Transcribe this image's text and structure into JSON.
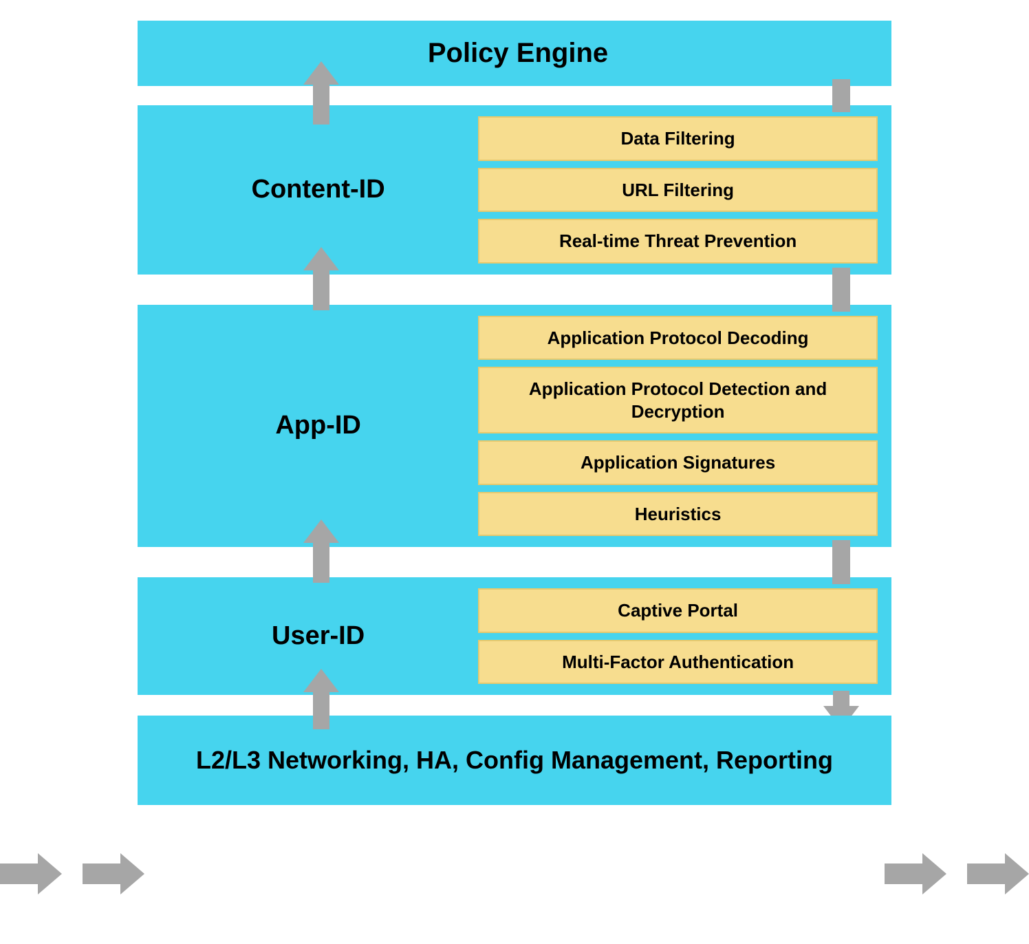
{
  "layers": {
    "policy": {
      "title": "Policy Engine"
    },
    "content": {
      "title": "Content-ID",
      "items": [
        "Data Filtering",
        "URL Filtering",
        "Real-time Threat Prevention"
      ]
    },
    "app": {
      "title": "App-ID",
      "items": [
        "Application Protocol Decoding",
        "Application Protocol Detection and Decryption",
        "Application Signatures",
        "Heuristics"
      ]
    },
    "user": {
      "title": "User-ID",
      "items": [
        "Captive Portal",
        "Multi-Factor Authentication"
      ]
    },
    "base": {
      "title": "L2/L3 Networking, HA, Config Management, Reporting"
    }
  }
}
